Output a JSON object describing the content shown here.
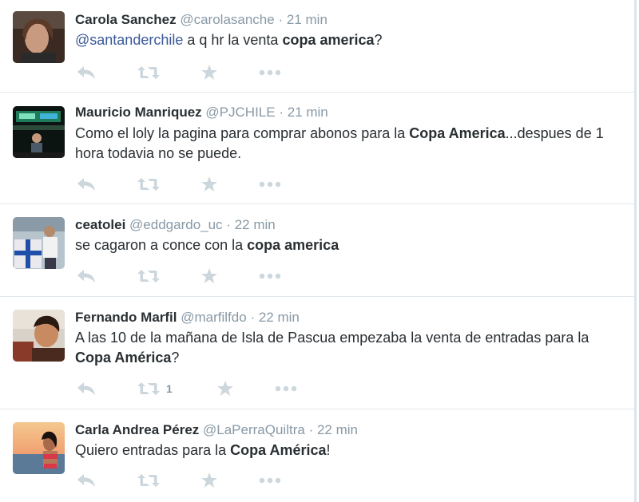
{
  "colors": {
    "username": "#8899a6",
    "action_icon": "#ccd6dd",
    "mention": "#3b5998",
    "divider": "#e1e8ed"
  },
  "tweets": [
    {
      "fullname": "Carola Sanchez",
      "username": "@carolasanche",
      "separator": "·",
      "time": "21 min",
      "text": [
        {
          "t": "@santanderchile",
          "s": "mention"
        },
        {
          "t": " a q hr la venta ",
          "s": ""
        },
        {
          "t": "copa america",
          "s": "bold"
        },
        {
          "t": "?",
          "s": ""
        }
      ],
      "retweet_count": "",
      "icons": [
        "reply-icon",
        "retweet-icon",
        "favorite-star-icon",
        "more-dots-icon"
      ]
    },
    {
      "fullname": "Mauricio Manriquez",
      "username": "@PJCHILE",
      "separator": "·",
      "time": "21 min",
      "text": [
        {
          "t": "Como el loly la pagina para comprar abonos para la ",
          "s": ""
        },
        {
          "t": "Copa America",
          "s": "bold"
        },
        {
          "t": "...despues de 1 hora todavia no se puede.",
          "s": ""
        }
      ],
      "retweet_count": "",
      "icons": [
        "reply-icon",
        "retweet-icon",
        "favorite-star-icon",
        "more-dots-icon"
      ]
    },
    {
      "fullname": "ceatolei",
      "username": "@eddgardo_uc",
      "separator": "·",
      "time": "22 min",
      "text": [
        {
          "t": "se cagaron a conce con la ",
          "s": ""
        },
        {
          "t": "copa america",
          "s": "bold"
        }
      ],
      "retweet_count": "",
      "icons": [
        "reply-icon",
        "retweet-icon",
        "favorite-star-icon",
        "more-dots-icon"
      ]
    },
    {
      "fullname": "Fernando Marfil",
      "username": "@marfilfdo",
      "separator": "·",
      "time": "22 min",
      "text": [
        {
          "t": "A las 10 de la mañana de Isla de Pascua empezaba la venta de entradas para la ",
          "s": ""
        },
        {
          "t": "Copa América",
          "s": "bold"
        },
        {
          "t": "?",
          "s": ""
        }
      ],
      "retweet_count": "1",
      "icons": [
        "reply-icon",
        "retweet-icon",
        "favorite-star-icon",
        "more-dots-icon"
      ]
    },
    {
      "fullname": "Carla Andrea Pérez",
      "username": "@LaPerraQuiltra",
      "separator": "·",
      "time": "22 min",
      "text": [
        {
          "t": "Quiero entradas para la ",
          "s": ""
        },
        {
          "t": "Copa América",
          "s": "bold"
        },
        {
          "t": "!",
          "s": ""
        }
      ],
      "retweet_count": "",
      "icons": [
        "reply-icon",
        "retweet-icon",
        "favorite-star-icon",
        "more-dots-icon"
      ]
    }
  ]
}
